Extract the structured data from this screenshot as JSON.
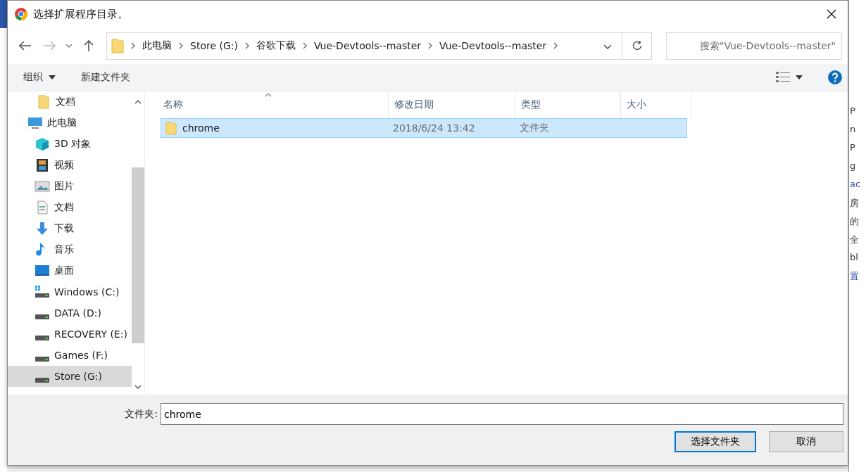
{
  "background": {
    "right_texts": [
      "P",
      "n",
      "P",
      "g",
      "ac",
      "房",
      "的",
      "全",
      "bl",
      "置"
    ]
  },
  "window": {
    "title": "选择扩展程序目录。"
  },
  "address_bar": {
    "crumbs": [
      "此电脑",
      "Store (G:)",
      "谷歌下载",
      "Vue-Devtools--master",
      "Vue-Devtools--master"
    ]
  },
  "search": {
    "placeholder": "搜索\"Vue-Devtools--master\""
  },
  "toolbar": {
    "organize": "组织",
    "new_folder": "新建文件夹"
  },
  "sidebar": {
    "items": [
      {
        "label": "文档",
        "kind": "folder",
        "selected": false
      },
      {
        "label": "此电脑",
        "kind": "pc",
        "selected": false,
        "children": [
          {
            "label": "3D 对象",
            "kind": "cube",
            "selected": false
          },
          {
            "label": "视频",
            "kind": "film",
            "selected": false
          },
          {
            "label": "图片",
            "kind": "image",
            "selected": false
          },
          {
            "label": "文档",
            "kind": "doc",
            "selected": false
          },
          {
            "label": "下载",
            "kind": "download",
            "selected": false
          },
          {
            "label": "音乐",
            "kind": "music",
            "selected": false
          },
          {
            "label": "桌面",
            "kind": "desktop",
            "selected": false
          },
          {
            "label": "Windows (C:)",
            "kind": "windrive",
            "selected": false
          },
          {
            "label": "DATA (D:)",
            "kind": "drive",
            "selected": false
          },
          {
            "label": "RECOVERY (E:)",
            "kind": "drive",
            "selected": false
          },
          {
            "label": "Games (F:)",
            "kind": "drive",
            "selected": false
          },
          {
            "label": "Store (G:)",
            "kind": "drive",
            "selected": true
          }
        ]
      }
    ]
  },
  "table": {
    "columns": [
      {
        "label": "名称",
        "sorted": true
      },
      {
        "label": "修改日期",
        "sorted": false
      },
      {
        "label": "类型",
        "sorted": false
      },
      {
        "label": "大小",
        "sorted": false
      }
    ],
    "rows": [
      {
        "name": "chrome",
        "date": "2018/6/24 13:42",
        "type": "文件夹",
        "selected": true
      }
    ]
  },
  "folder_field": {
    "label": "文件夹:",
    "value": "chrome"
  },
  "buttons": [
    {
      "label": "选择文件夹",
      "kind": "primary"
    },
    {
      "label": "取消",
      "kind": "secondary"
    }
  ]
}
